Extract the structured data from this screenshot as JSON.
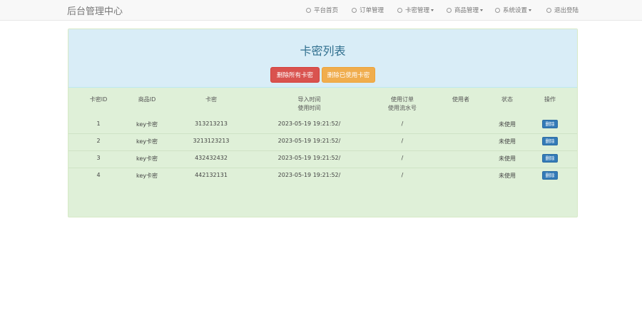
{
  "header": {
    "brand": "后台管理中心",
    "nav": [
      {
        "label": "平台首页",
        "dropdown": false
      },
      {
        "label": "订单管理",
        "dropdown": false
      },
      {
        "label": "卡密管理",
        "dropdown": true
      },
      {
        "label": "商品管理",
        "dropdown": true
      },
      {
        "label": "系统设置",
        "dropdown": true
      },
      {
        "label": "退出登陆",
        "dropdown": false
      }
    ]
  },
  "panel": {
    "title": "卡密列表",
    "buttons": {
      "delete_all": "删除所有卡密",
      "delete_used": "删除已使用卡密"
    }
  },
  "table": {
    "columns": {
      "id": "卡密ID",
      "product_id": "商品ID",
      "card": "卡密",
      "times_line1": "导入时间",
      "times_line2": "使用时间",
      "order_line1": "使用订单",
      "order_line2": "使用流水号",
      "user": "使用者",
      "status": "状态",
      "action": "操作"
    },
    "rows": [
      {
        "id": "1",
        "product_id": "key卡密",
        "card": "313213213",
        "time": "2023-05-19 19:21:52/",
        "order": "/",
        "user": "",
        "status": "未使用",
        "action": "删除"
      },
      {
        "id": "2",
        "product_id": "key卡密",
        "card": "3213123213",
        "time": "2023-05-19 19:21:52/",
        "order": "/",
        "user": "",
        "status": "未使用",
        "action": "删除"
      },
      {
        "id": "3",
        "product_id": "key卡密",
        "card": "432432432",
        "time": "2023-05-19 19:21:52/",
        "order": "/",
        "user": "",
        "status": "未使用",
        "action": "删除"
      },
      {
        "id": "4",
        "product_id": "key卡密",
        "card": "442132131",
        "time": "2023-05-19 19:21:52/",
        "order": "/",
        "user": "",
        "status": "未使用",
        "action": "删除"
      }
    ]
  },
  "colors": {
    "panel_bg": "#dff0d8",
    "header_bg": "#d9edf7",
    "danger": "#d9534f",
    "warning": "#f0ad4e",
    "primary": "#337ab7"
  }
}
